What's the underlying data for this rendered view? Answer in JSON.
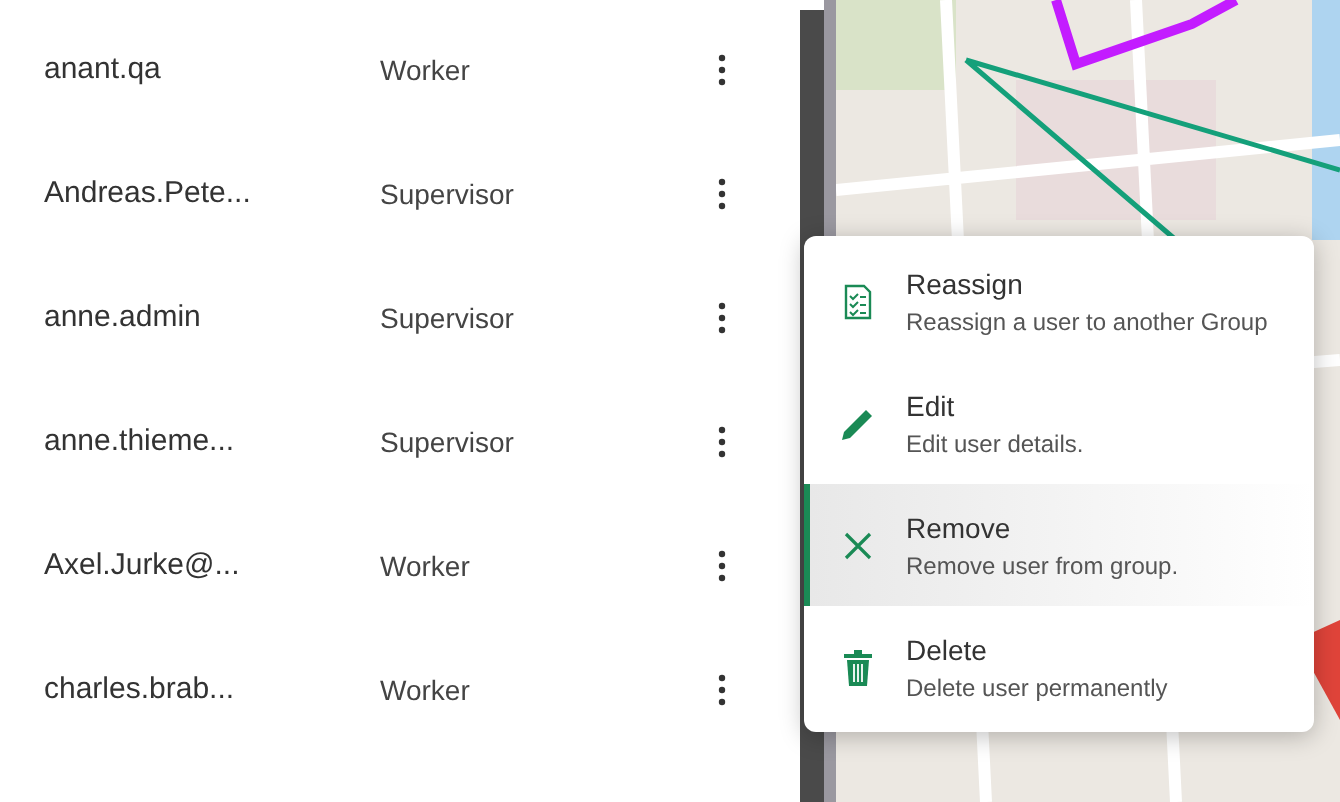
{
  "users": [
    {
      "name": "anant.qa",
      "role": "Worker"
    },
    {
      "name": "Andreas.Pete...",
      "role": "Supervisor"
    },
    {
      "name": "anne.admin",
      "role": "Supervisor"
    },
    {
      "name": "anne.thieme...",
      "role": "Supervisor"
    },
    {
      "name": "Axel.Jurke@...",
      "role": "Worker"
    },
    {
      "name": "charles.brab...",
      "role": "Worker"
    }
  ],
  "context_menu": {
    "items": [
      {
        "kind": "reassign",
        "title": "Reassign",
        "description": "Reassign a user to another Group",
        "selected": false
      },
      {
        "kind": "edit",
        "title": "Edit",
        "description": "Edit user details.",
        "selected": false
      },
      {
        "kind": "remove",
        "title": "Remove",
        "description": "Remove user from group.",
        "selected": true
      },
      {
        "kind": "delete",
        "title": "Delete",
        "description": "Delete user permanently",
        "selected": false
      }
    ]
  }
}
